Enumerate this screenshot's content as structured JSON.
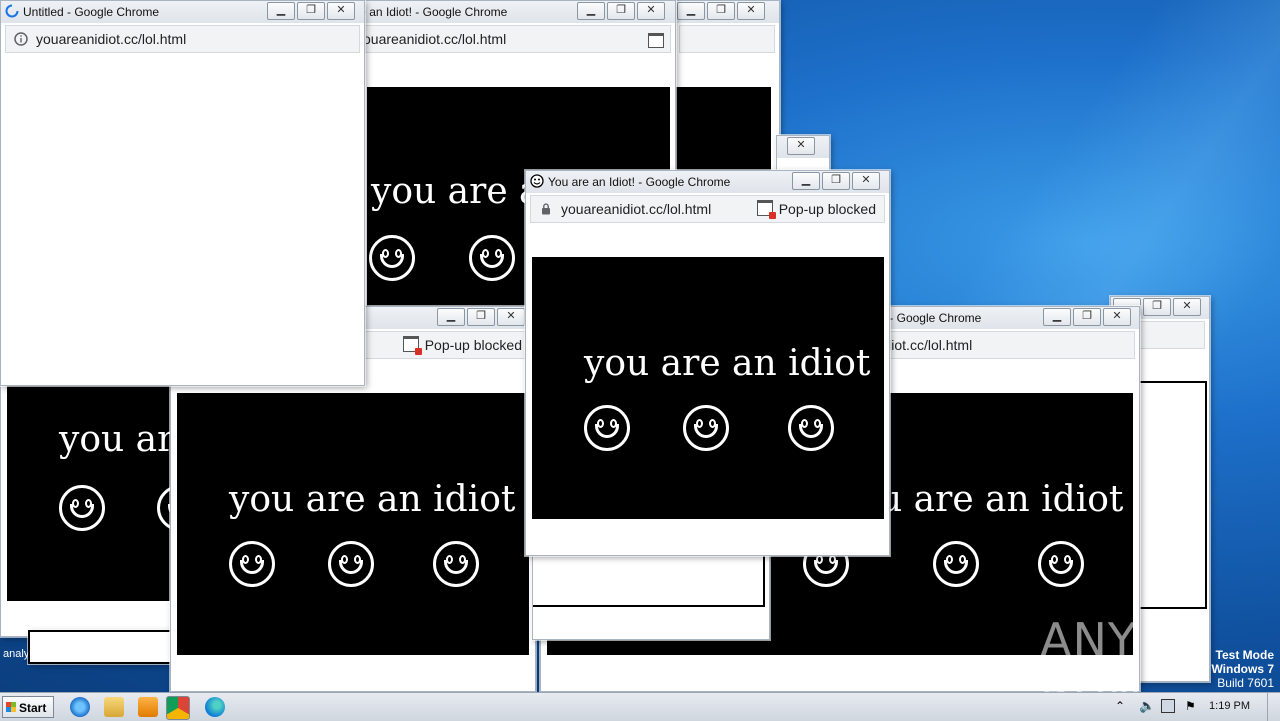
{
  "desktop": {
    "analysis_label": "analy",
    "watermark": "ANY ▷ RUN",
    "test_mode": "Test Mode",
    "os_name": "Windows 7",
    "build": "Build 7601"
  },
  "windows": {
    "untitled": {
      "title": "Untitled - Google Chrome",
      "url": "youareanidiot.cc/lol.html"
    },
    "back_top": {
      "title": "You are an Idiot! - Google Chrome",
      "url": "youareanidiot.cc/lol.html",
      "panel_text": "you are an idiot"
    },
    "front": {
      "title": "You are an Idiot! - Google Chrome",
      "url": "youareanidiot.cc/lol.html",
      "popup_blocked": "Pop-up blocked",
      "panel_text": "you are an idiot"
    },
    "mid_left": {
      "popup_blocked": "Pop-up blocked",
      "panel_text": "you are an idiot"
    },
    "right": {
      "title": "You are an Idiot! - Google Chrome",
      "url": "youareanidiot.cc/lol.html",
      "panel_text": "you are an idiot"
    },
    "left_bottom": {
      "panel_text": "you are an idiot"
    }
  },
  "window_controls": {
    "minimize": "▁",
    "maximize": "❐",
    "close": "✕"
  },
  "taskbar": {
    "start_label": "Start",
    "clock": "1:19 PM"
  }
}
